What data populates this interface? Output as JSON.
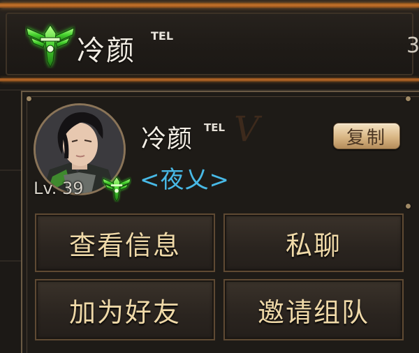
{
  "header": {
    "player_name": "冷颜",
    "name_suffix": "TEL",
    "right_value": "3"
  },
  "profile": {
    "name": "冷颜",
    "name_suffix": "TEL",
    "level": "Lv. 39",
    "guild": "<夜乂>",
    "copy_label": "复制"
  },
  "actions": {
    "view_info": "查看信息",
    "private_chat": "私聊",
    "add_friend": "加为好友",
    "invite_team": "邀请组队"
  },
  "colors": {
    "guild_text": "#48b9e6",
    "rank_badge": "#45d12e",
    "frame_accent": "#c7732a",
    "button_text": "#efd9a8"
  },
  "icons": {
    "rank_badge": "green-winged-rank-badge-icon"
  }
}
